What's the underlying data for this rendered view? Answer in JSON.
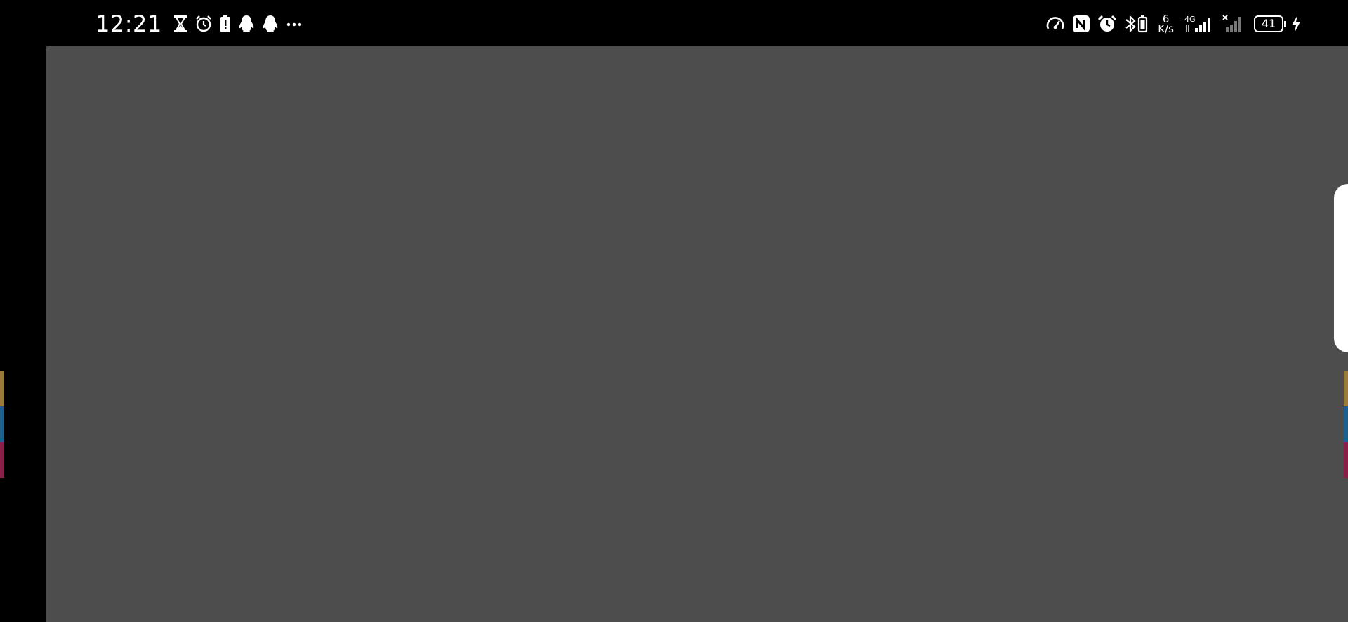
{
  "status_bar": {
    "time": "12:21",
    "left_icons": [
      "hourglass-icon",
      "alarm-clock-icon",
      "battery-alert-icon",
      "qq-penguin-icon",
      "qq-penguin-icon",
      "more-dots-icon"
    ],
    "right_icons": [
      "speedometer-icon",
      "nfc-icon",
      "alarm-icon",
      "bluetooth-battery-icon",
      "signal-4g-icon",
      "signal-no-service-icon",
      "battery-icon",
      "charging-icon"
    ],
    "network_speed_value": "6",
    "network_speed_unit": "K/s",
    "network_type": "4G",
    "battery_level": "41"
  },
  "colors": {
    "background": "#000000",
    "app_canvas": "#4d4d4d",
    "side_handle": "#ffffff",
    "edge_strip": [
      "#9a7a3a",
      "#1f5f8b",
      "#8b1f4a"
    ]
  }
}
